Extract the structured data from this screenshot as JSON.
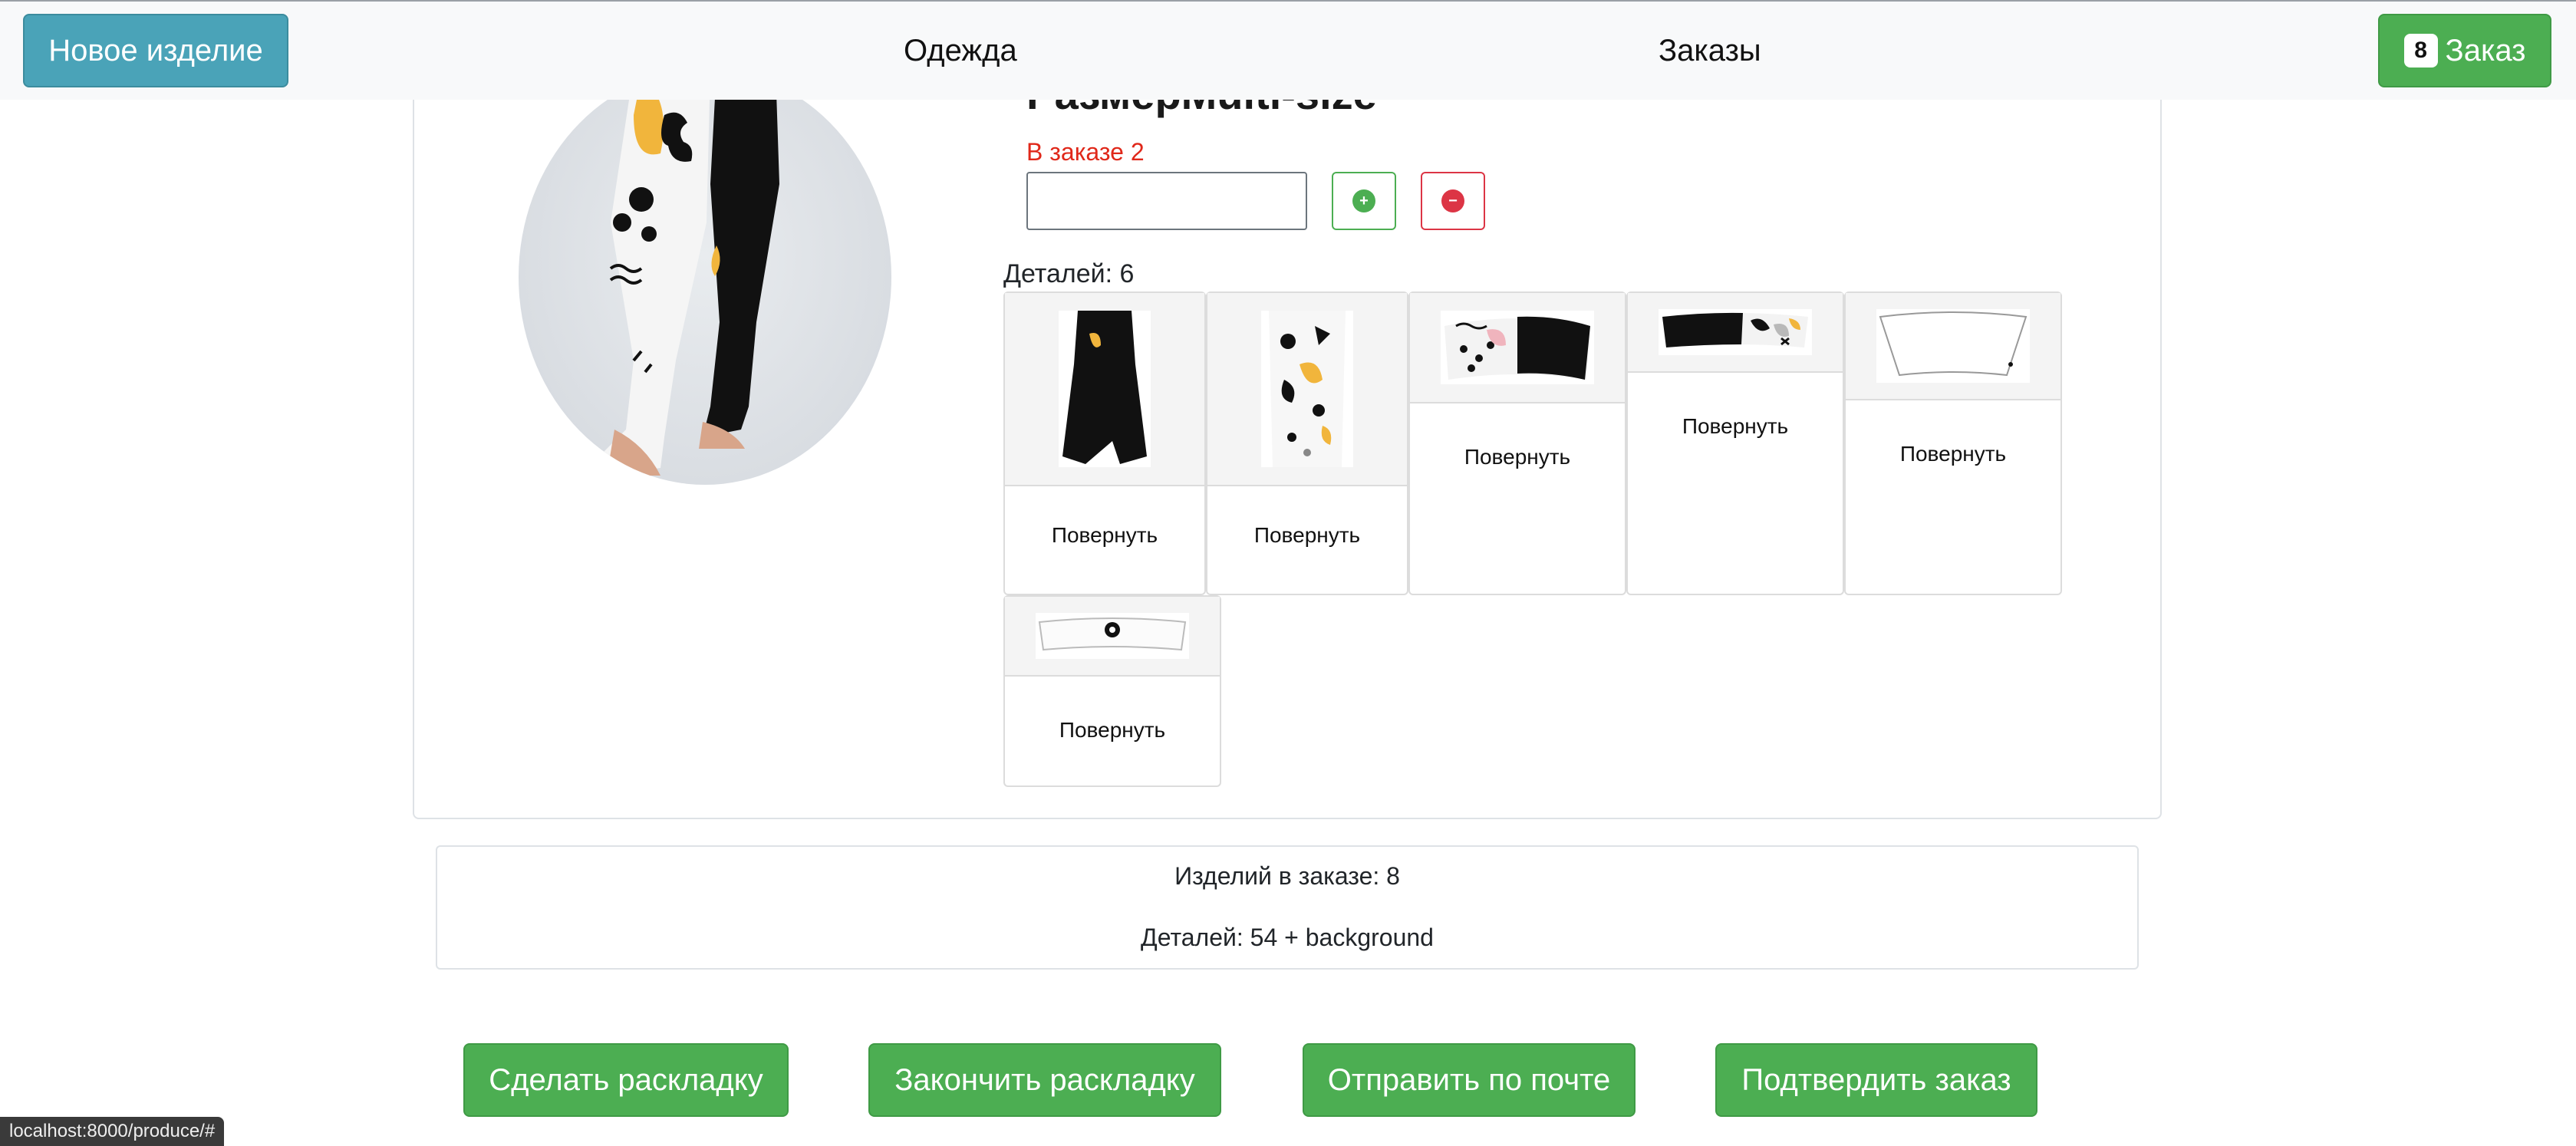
{
  "navbar": {
    "new_item_label": "Новое изделие",
    "clothes_link": "Одежда",
    "orders_link": "Заказы",
    "cart_count": "8",
    "cart_label": "Заказ"
  },
  "product": {
    "size_title": "РазмерMulti-size",
    "in_order_text": "В заказе 2",
    "qty_value": "",
    "details_label": "Деталей: 6",
    "parts": [
      {
        "rotate_label": "Повернуть"
      },
      {
        "rotate_label": "Повернуть"
      },
      {
        "rotate_label": "Повернуть"
      },
      {
        "rotate_label": "Повернуть"
      },
      {
        "rotate_label": "Повернуть"
      },
      {
        "rotate_label": "Повернуть"
      }
    ]
  },
  "summary": {
    "items_in_order": "Изделий в заказе: 8",
    "details_total": "Деталей: 54 + background"
  },
  "actions": {
    "make_layout": "Сделать раскладку",
    "finish_layout": "Закончить раскладку",
    "send_mail": "Отправить по почте",
    "confirm_order": "Подтвердить заказ"
  },
  "status_bar": {
    "url": "localhost:8000/produce/#"
  },
  "colors": {
    "info": "#4aa3b8",
    "success": "#4cae52",
    "danger": "#dc3545",
    "alert_text": "#e0281a"
  }
}
